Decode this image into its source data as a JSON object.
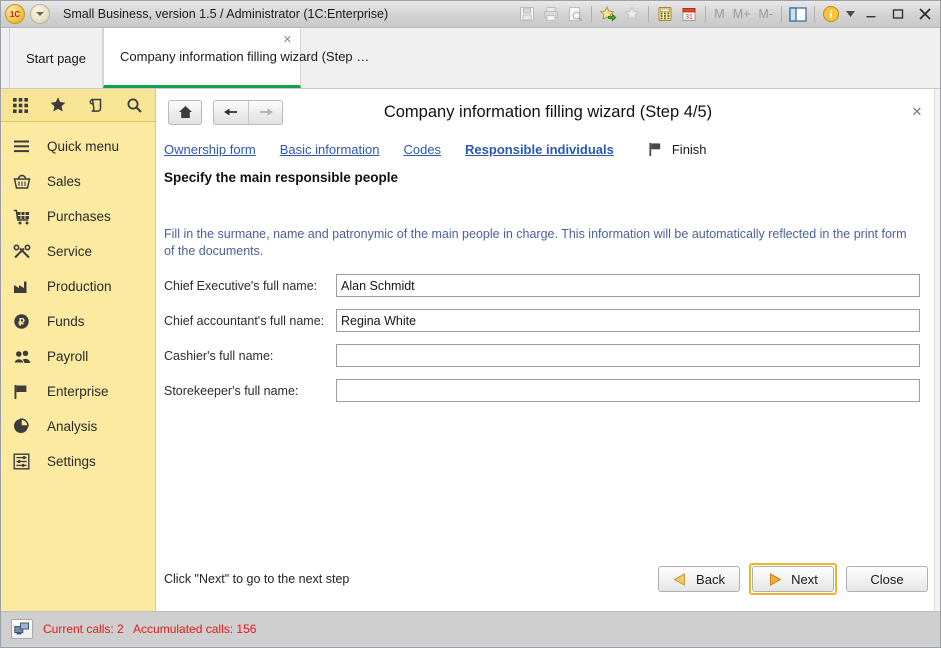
{
  "window": {
    "title": "Small Business, version 1.5 / Administrator  (1C:Enterprise)",
    "logo_text": "1C",
    "logo_icon": "1c-logo-icon",
    "dropdown_icon": "chevron-down-icon",
    "toolbar": [
      {
        "name": "save-icon",
        "label": "Save",
        "enabled": false
      },
      {
        "name": "print-icon",
        "label": "Print",
        "enabled": false
      },
      {
        "name": "print-preview-icon",
        "label": "Print preview",
        "enabled": false
      },
      {
        "name": "add-to-favorites-icon",
        "label": "Add to favorites",
        "enabled": true
      },
      {
        "name": "favorites-icon",
        "label": "Favorites",
        "enabled": false
      },
      {
        "name": "calculator-icon",
        "label": "Calculator",
        "enabled": true
      },
      {
        "name": "calendar-icon",
        "label": "Calendar",
        "enabled": true
      }
    ],
    "calendar_day": "31",
    "memory_buttons": [
      "M",
      "M+",
      "M-"
    ],
    "split_icon": "window-split-icon",
    "info_icon": "info-icon",
    "info_dropdown_icon": "chevron-down-icon",
    "minimize_label": "–",
    "maximize_label": "□",
    "close_label": "✕"
  },
  "tabs": [
    {
      "label": "Start page",
      "active": false
    },
    {
      "label": "Company information filling wizard (Step …",
      "active": true,
      "close_label": "✕"
    }
  ],
  "sidebar": {
    "tools": [
      {
        "name": "apps-grid-icon",
        "label": "All functions"
      },
      {
        "name": "star-icon",
        "label": "Favorites"
      },
      {
        "name": "history-icon",
        "label": "History"
      },
      {
        "name": "search-icon",
        "label": "Search"
      }
    ],
    "items": [
      {
        "label": "Quick menu",
        "icon": "hamburger-menu-icon"
      },
      {
        "label": "Sales",
        "icon": "shopping-basket-icon"
      },
      {
        "label": "Purchases",
        "icon": "shopping-cart-icon"
      },
      {
        "label": "Service",
        "icon": "tools-icon"
      },
      {
        "label": "Production",
        "icon": "factory-icon"
      },
      {
        "label": "Funds",
        "icon": "currency-coin-icon"
      },
      {
        "label": "Payroll",
        "icon": "people-icon"
      },
      {
        "label": "Enterprise",
        "icon": "flag-icon"
      },
      {
        "label": "Analysis",
        "icon": "pie-chart-icon"
      },
      {
        "label": "Settings",
        "icon": "sliders-icon"
      }
    ]
  },
  "form": {
    "title": "Company information filling wizard (Step 4/5)",
    "close_label": "✕",
    "home_icon": "home-icon",
    "back_icon": "arrow-left-icon",
    "forward_icon": "arrow-right-icon",
    "steps": [
      {
        "label": "Ownership form",
        "current": false
      },
      {
        "label": "Basic information",
        "current": false
      },
      {
        "label": "Codes",
        "current": false
      },
      {
        "label": "Responsible individuals",
        "current": true
      }
    ],
    "finish": {
      "label": "Finish",
      "icon": "flag-icon"
    },
    "subtitle": "Specify the main responsible people",
    "hint": "Fill in the surmane, name and patronymic of the main people in charge. This information will be automatically reflected in the print form of the documents.",
    "fields": [
      {
        "label": "Chief Executive's full name:",
        "value": "Alan Schmidt",
        "placeholder": ""
      },
      {
        "label": "Chief accountant's full name:",
        "value": "Regina White",
        "placeholder": ""
      },
      {
        "label": "Cashier's full name:",
        "value": "",
        "placeholder": ""
      },
      {
        "label": "Storekeeper's full name:",
        "value": "",
        "placeholder": ""
      }
    ],
    "footer_note": "Click \"Next\" to go to the next step",
    "buttons": {
      "back": {
        "label": "Back",
        "icon": "triangle-left-icon"
      },
      "next": {
        "label": "Next",
        "icon": "triangle-right-icon",
        "focused": true
      },
      "close": {
        "label": "Close"
      }
    }
  },
  "statusbar": {
    "icon": "network-connection-icon",
    "text": "Current calls: 2   Accumulated calls: 156"
  },
  "colors": {
    "sidebar_bg": "#fbeaa0",
    "active_tab_underline": "#12a04b",
    "link": "#2b57b5",
    "hint_text": "#4c5f9c",
    "status_text": "#e01b1b",
    "focus_ring": "#f0b429"
  }
}
